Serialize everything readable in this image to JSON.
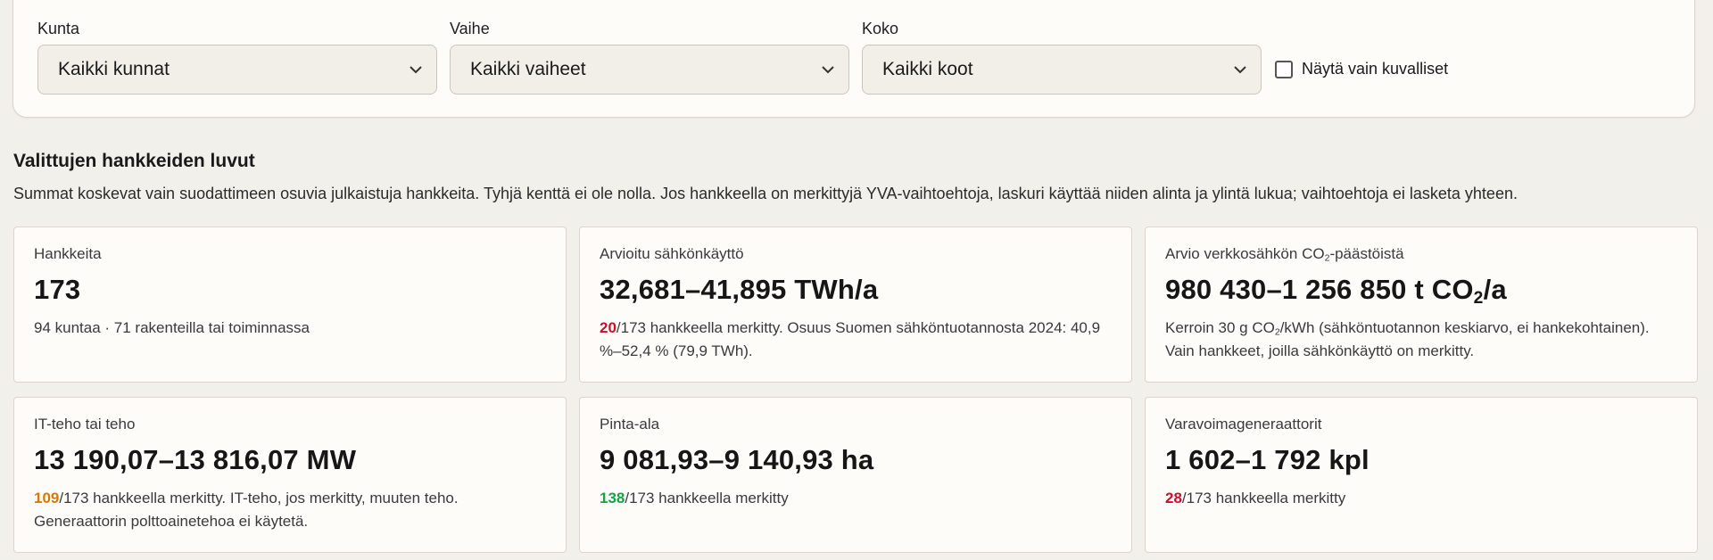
{
  "filters": {
    "kunta": {
      "label": "Kunta",
      "value": "Kaikki kunnat"
    },
    "vaihe": {
      "label": "Vaihe",
      "value": "Kaikki vaiheet"
    },
    "koko": {
      "label": "Koko",
      "value": "Kaikki koot"
    },
    "checkbox": {
      "label": "Näytä vain kuvalliset",
      "checked": false
    }
  },
  "summary": {
    "title": "Valittujen hankkeiden luvut",
    "description": "Summat koskevat vain suodattimeen osuvia julkaistuja hankkeita. Tyhjä kenttä ei ole nolla. Jos hankkeella on merkittyjä YVA-vaihtoehtoja, laskuri käyttää niiden alinta ja ylintä lukua; vaihtoehtoja ei lasketa yhteen."
  },
  "cards": {
    "hankkeita": {
      "label": "Hankkeita",
      "value": "173",
      "note": "94 kuntaa · 71 rakenteilla tai toiminnassa"
    },
    "sahko": {
      "label": "Arvioitu sähkönkäyttö",
      "value": "32,681–41,895 TWh/a",
      "count": "20",
      "note": "/173 hankkeella merkitty. Osuus Suomen sähköntuotannosta 2024: 40,9 %–52,4 % (79,9 TWh).",
      "count_color": "#c8102e"
    },
    "co2": {
      "label_pre": "Arvio verkkosähkön CO",
      "label_sub": "2",
      "label_post": "-päästöistä",
      "value_pre": "980 430–1 256 850 t CO",
      "value_sub": "2",
      "value_post": "/a",
      "note_pre": "Kerroin 30 g CO",
      "note_sub": "2",
      "note_post": "/kWh (sähköntuotannon keskiarvo, ei hankekohtainen). Vain hankkeet, joilla sähkönkäyttö on merkitty."
    },
    "teho": {
      "label": "IT-teho tai teho",
      "value": "13 190,07–13 816,07 MW",
      "count": "109",
      "note": "/173 hankkeella merkitty. IT-teho, jos merkitty, muuten teho. Generaattorin polttoainetehoa ei käytetä.",
      "count_color": "#d97706"
    },
    "pinta": {
      "label": "Pinta-ala",
      "value": "9 081,93–9 140,93 ha",
      "count": "138",
      "note": "/173 hankkeella merkitty",
      "count_color": "#16a34a"
    },
    "vara": {
      "label": "Varavoimageneraattorit",
      "value": "1 602–1 792 kpl",
      "count": "28",
      "note": "/173 hankkeella merkitty",
      "count_color": "#c8102e"
    }
  },
  "icons": {
    "select_chevron": "chevron-down-icon",
    "checkbox": "checkbox-unchecked"
  },
  "colors": {
    "background": "#f2f0ea",
    "card": "#fdfcf8",
    "red": "#c8102e",
    "orange": "#d97706",
    "green": "#16a34a"
  }
}
